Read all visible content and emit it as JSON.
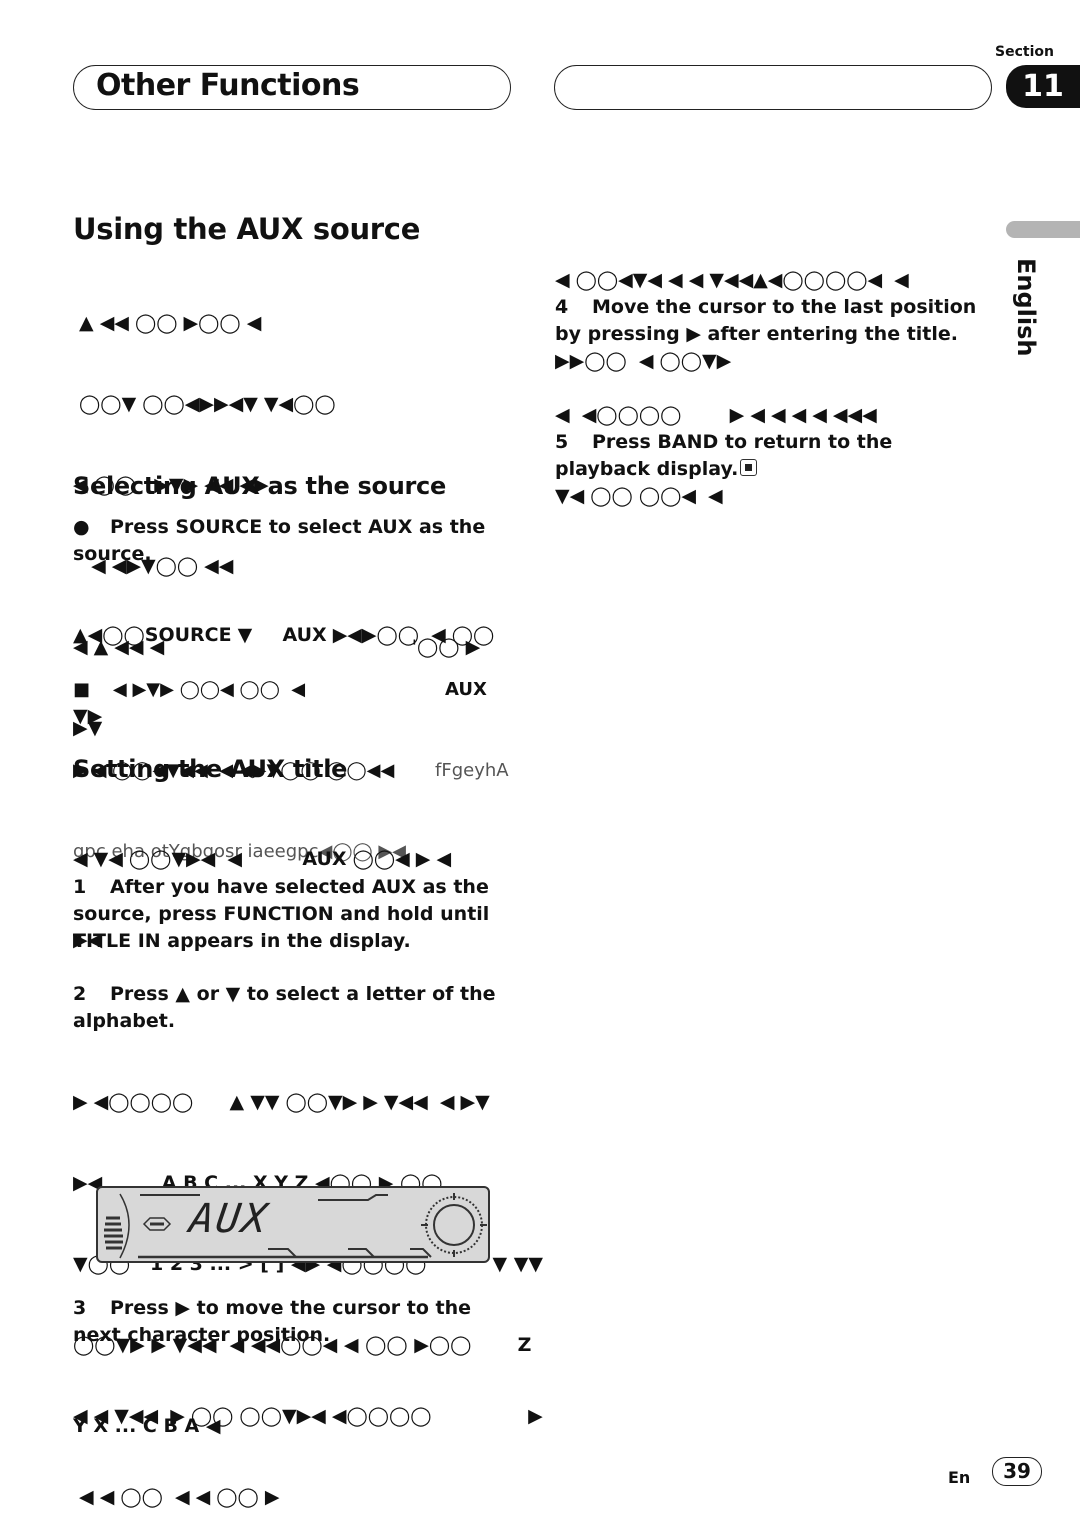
{
  "header": {
    "title": "Other Functions",
    "section_label": "Section",
    "section_number": "11"
  },
  "sidebar": {
    "language": "English"
  },
  "left": {
    "using_aux": {
      "heading": "Using the AUX source",
      "lines": [
        " ▲ ◀◀ ◯◯ ▶◯◯ ◀",
        " ◯◯▼ ◯◯◀▶▶◀▼ ▼◀◯◯",
        "◀ ◯◯   ▶▼▶ ◀◀ ◀▶",
        "   ◀ ◀▶▼◯◯ ◀◀",
        "◀ ▲ ◀◀ ◀                                         '◯◯ ▶",
        "▶▼"
      ]
    },
    "selecting": {
      "heading": "Selecting AUX as the source",
      "bullet_step": "Press SOURCE to select AUX as the source.",
      "line1_a": "▲◀◯◯",
      "line1_source": "SOURCE",
      "line1_b": " ▼     ",
      "line1_aux": "AUX",
      "line1_c": " ▶◀▶◯◯  ◀ ◯◯",
      "line2": "▼▶",
      "note_line1": "■    ◀ ▶▼▶ ◯◯◀ ◯◯  ◀",
      "note_aux": "AUX",
      "note_line2": "▶ ◀ ◯◯◀▼◀◀  ◀ ◀▶▼◯◯ ◯◯◀◀",
      "note_garble1": "fFgeyhA",
      "note_line3": "gpc eha otYgbgosr iaeegpc◀◯◯ ▶◀"
    },
    "setting_title": {
      "heading": "Setting the AUX title",
      "intro_a": "◀ ▼◀ ◯◯▼▶◀  ◀          ",
      "intro_aux": "AUX",
      "intro_b": " ◯◯◀ ▶ ◀",
      "intro_c": "▶◀",
      "step1_num": "1",
      "step1": "After you have selected AUX as the source, press FUNCTION and hold until TITLE IN appears in the display.",
      "step2_num": "2",
      "step2": "Press ▲ or ▼ to select a letter of the alphabet.",
      "step2_lines": [
        "▶ ◀◯◯◯◯      ▲ ▼▼ ◯◯▼▶ ▶ ▼◀◀  ◀ ▶▼",
        "▶◀         A B C ... X Y Z ◀◯◯ ▶ ◯◯",
        "▼◯◯   1 2 3 ... > [ ] ◀▶ ◀◯◯◯◯          ▼ ▼▼",
        "◯◯▼▶ ▶ ▼◀◀  ◀ ◀◀◯◯◀ ◀ ◯◯ ▶◯◯       Z",
        "Y X ... C B A ◀"
      ],
      "lcd_text": "AUX",
      "step3_num": "3",
      "step3": "Press ▶ to move the cursor to the next character position.",
      "step3_lines": [
        "◀ ◀ ▼◀◀  ▶ ◯◯ ◯◯▼▶◀ ◀◯◯◯◯                ▶",
        " ◀ ◀ ◯◯  ◀ ◀ ◯◯ ▶"
      ]
    }
  },
  "right": {
    "cont_lines": [
      "◀ ◯◯◀▼◀ ◀ ◀ ▼◀◀▲◀◯◯◯◯◀  ◀",
      "▶▶◯◯  ◀ ◯◯▼▶"
    ],
    "step4_num": "4",
    "step4": "Move the cursor to the last position by pressing ▶ after entering the title.",
    "step4_lines": [
      "◀  ◀◯◯◯◯        ▶ ◀ ◀ ◀ ◀ ◀◀◀",
      "▼◀ ◯◯ ◯◯◀  ◀"
    ],
    "step5_num": "5",
    "step5": "Press BAND to return to the playback display."
  },
  "footer": {
    "lang_code": "En",
    "page_number": "39"
  }
}
